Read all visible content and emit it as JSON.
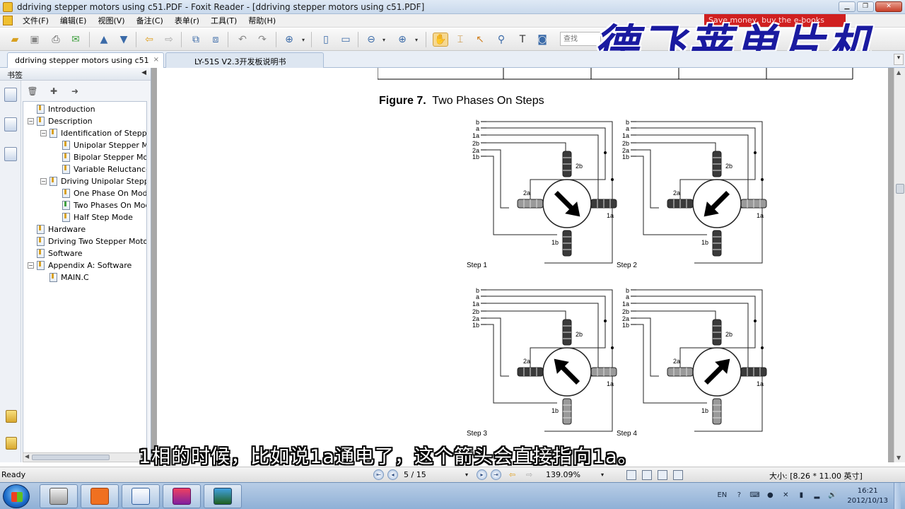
{
  "window": {
    "title": "ddriving stepper motors using c51.PDF - Foxit Reader - [ddriving stepper motors using c51.PDF]",
    "buttons": [
      "▁",
      "❐",
      "✕"
    ]
  },
  "menu": {
    "items": [
      "文件(F)",
      "编辑(E)",
      "视图(V)",
      "备注(C)",
      "表单(r)",
      "工具(T)",
      "帮助(H)"
    ]
  },
  "toolbar": {
    "search_placeholder": "查找"
  },
  "overlay": {
    "watermark": "德飞莱单片机",
    "banner": "Save money, buy the e-books"
  },
  "tabs": [
    {
      "label": "ddriving stepper motors using c51",
      "close": "×"
    },
    {
      "label": "LY-51S V2.3开发板说明书"
    }
  ],
  "sidebar": {
    "header": "书签",
    "bookmarks": [
      {
        "label": "Introduction",
        "level": 0,
        "twisty": ""
      },
      {
        "label": "Description",
        "level": 0,
        "twisty": "−"
      },
      {
        "label": "Identification of Stepper Motors",
        "level": 1,
        "twisty": "−"
      },
      {
        "label": "Unipolar Stepper Motors",
        "level": 2,
        "twisty": ""
      },
      {
        "label": "Bipolar Stepper Motors",
        "level": 2,
        "twisty": ""
      },
      {
        "label": "Variable Reluctance",
        "level": 2,
        "twisty": ""
      },
      {
        "label": "Driving Unipolar Stepper Motors",
        "level": 1,
        "twisty": "−"
      },
      {
        "label": "One Phase On Mode",
        "level": 2,
        "twisty": ""
      },
      {
        "label": "Two Phases On Mode",
        "level": 2,
        "twisty": "",
        "active": true
      },
      {
        "label": "Half Step Mode",
        "level": 2,
        "twisty": ""
      },
      {
        "label": "Hardware",
        "level": 0,
        "twisty": ""
      },
      {
        "label": "Driving Two Stepper Motors",
        "level": 0,
        "twisty": ""
      },
      {
        "label": "Software",
        "level": 0,
        "twisty": ""
      },
      {
        "label": "Appendix A: Software",
        "level": 0,
        "twisty": "−"
      },
      {
        "label": "MAIN.C",
        "level": 1,
        "twisty": ""
      }
    ]
  },
  "document": {
    "figure_number": "Figure 7.",
    "figure_title": "Two Phases On Steps",
    "wire_labels": [
      "b",
      "a",
      "1a",
      "2b",
      "2a",
      "1b"
    ],
    "steps": [
      {
        "label": "Step 1",
        "arrow_angle": 45
      },
      {
        "label": "Step 2",
        "arrow_angle": 135
      },
      {
        "label": "Step 3",
        "arrow_angle": -135
      },
      {
        "label": "Step 4",
        "arrow_angle": -45
      }
    ],
    "coil_labels": {
      "top": "2b",
      "left": "2a",
      "right": "1a",
      "bottom": "1b"
    }
  },
  "subtitle": "1相的时候，比如说1a通电了，这个箭头会直接指向1a。",
  "statusbar": {
    "ready": "Ready",
    "page": "5 / 15",
    "zoom": "139.09%",
    "size": "大小: [8.26 * 11.00 英寸]"
  },
  "taskbar": {
    "lang": "EN",
    "time": "16:21",
    "date": "2012/10/13",
    "apps": [
      "explorer",
      "presentation",
      "editor",
      "media",
      "screen"
    ]
  }
}
